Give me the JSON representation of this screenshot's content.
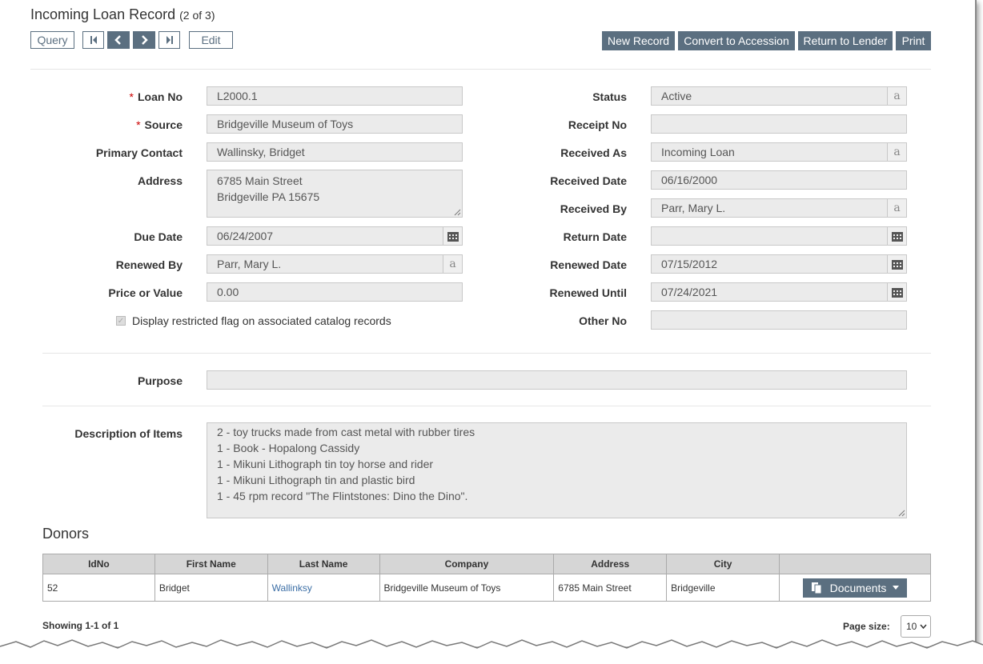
{
  "header": {
    "title": "Incoming Loan Record",
    "record_count": "(2 of 3)"
  },
  "toolbar": {
    "query_label": "Query",
    "edit_label": "Edit",
    "new_record_label": "New Record",
    "convert_label": "Convert to Accession",
    "return_label": "Return to Lender",
    "print_label": "Print"
  },
  "form": {
    "loan_no": {
      "label": "Loan No",
      "value": "L2000.1",
      "required": true
    },
    "source": {
      "label": "Source",
      "value": "Bridgeville Museum of Toys",
      "required": true
    },
    "primary_contact": {
      "label": "Primary Contact",
      "value": "Wallinsky, Bridget"
    },
    "address": {
      "label": "Address",
      "line1": "6785 Main Street",
      "line2": "Bridgeville PA 15675"
    },
    "due_date": {
      "label": "Due Date",
      "value": "06/24/2007"
    },
    "renewed_by": {
      "label": "Renewed By",
      "value": "Parr, Mary L."
    },
    "price_or_value": {
      "label": "Price or Value",
      "value": "0.00"
    },
    "restricted_flag": {
      "label": "Display restricted flag on associated catalog records",
      "checked": true
    },
    "status": {
      "label": "Status",
      "value": "Active"
    },
    "receipt_no": {
      "label": "Receipt No",
      "value": ""
    },
    "received_as": {
      "label": "Received As",
      "value": "Incoming Loan"
    },
    "received_date": {
      "label": "Received Date",
      "value": "06/16/2000"
    },
    "received_by": {
      "label": "Received By",
      "value": "Parr, Mary L."
    },
    "return_date": {
      "label": "Return Date",
      "value": ""
    },
    "renewed_date": {
      "label": "Renewed Date",
      "value": "07/15/2012"
    },
    "renewed_until": {
      "label": "Renewed Until",
      "value": "07/24/2021"
    },
    "other_no": {
      "label": "Other No",
      "value": ""
    },
    "purpose": {
      "label": "Purpose",
      "value": ""
    },
    "description": {
      "label": "Description of Items",
      "lines": [
        "2 - toy trucks made from cast metal with rubber tires",
        "1 - Book - Hopalong Cassidy",
        "1 - Mikuni Lithograph tin toy horse and rider",
        "1 - Mikuni Lithograph tin and plastic bird",
        "1 - 45 rpm record \"The Flintstones: Dino the Dino\"."
      ]
    },
    "lookup_glyph": "a"
  },
  "donors": {
    "heading": "Donors",
    "columns": [
      "IdNo",
      "First Name",
      "Last Name",
      "Company",
      "Address",
      "City",
      ""
    ],
    "rows": [
      {
        "idno": "52",
        "first_name": "Bridget",
        "last_name": "Wallinksy",
        "company": "Bridgeville Museum of Toys",
        "address": "6785 Main Street",
        "city": "Bridgeville",
        "action": "Documents"
      }
    ],
    "showing": "Showing 1-1 of 1",
    "page_size_label": "Page size:",
    "page_size_value": "10"
  },
  "colors": {
    "accent": "#5b6f80",
    "link": "#3b6ea5",
    "required": "#cc0000",
    "field_bg": "#ebebeb"
  },
  "icons": [
    "first-record-icon",
    "previous-record-icon",
    "next-record-icon",
    "last-record-icon",
    "calendar-icon",
    "lookup-icon",
    "documents-icon",
    "caret-down-icon",
    "checkmark-icon",
    "resize-grip-icon"
  ]
}
